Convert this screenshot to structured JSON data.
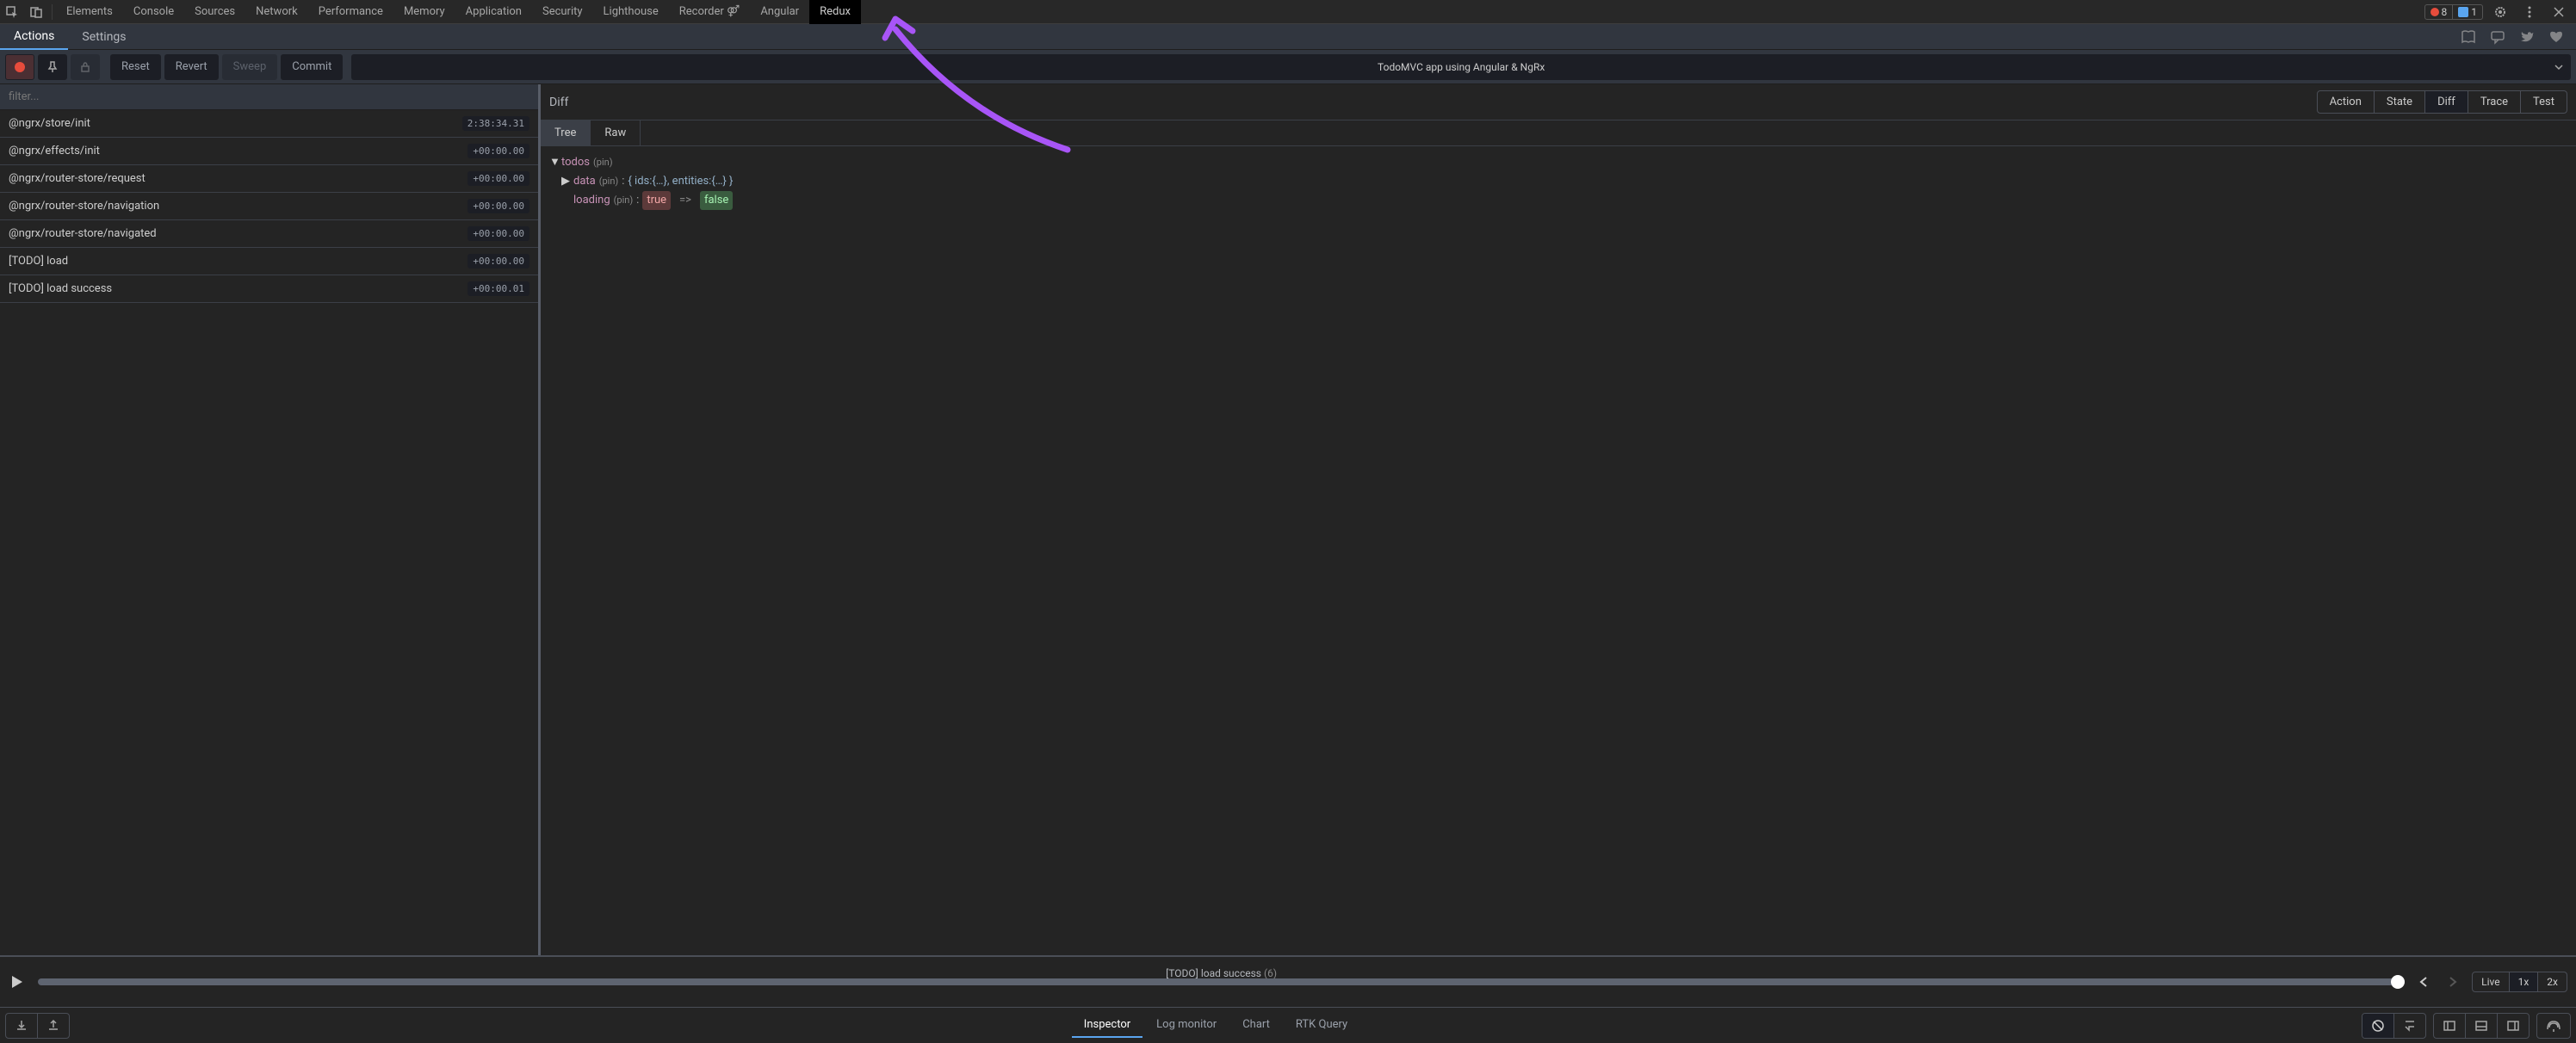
{
  "devtools": {
    "tabs": [
      "Elements",
      "Console",
      "Sources",
      "Network",
      "Performance",
      "Memory",
      "Application",
      "Security",
      "Lighthouse",
      "Recorder ⚤",
      "Angular",
      "Redux"
    ],
    "active_tab": "Redux",
    "error_count": "8",
    "issue_count": "1"
  },
  "redux_subtabs": {
    "tabs": [
      "Actions",
      "Settings"
    ],
    "active": "Actions"
  },
  "toolbar": {
    "reset": "Reset",
    "revert": "Revert",
    "sweep": "Sweep",
    "commit": "Commit",
    "title": "TodoMVC app using Angular & NgRx"
  },
  "filter": {
    "placeholder": "filter..."
  },
  "actions": [
    {
      "name": "@ngrx/store/init",
      "ts": "2:38:34.31"
    },
    {
      "name": "@ngrx/effects/init",
      "ts": "+00:00.00"
    },
    {
      "name": "@ngrx/router-store/request",
      "ts": "+00:00.00"
    },
    {
      "name": "@ngrx/router-store/navigation",
      "ts": "+00:00.00"
    },
    {
      "name": "@ngrx/router-store/navigated",
      "ts": "+00:00.00"
    },
    {
      "name": "[TODO] load",
      "ts": "+00:00.00"
    },
    {
      "name": "[TODO] load success",
      "ts": "+00:00.01"
    }
  ],
  "diff": {
    "header": "Diff",
    "view_pills": [
      "Action",
      "State",
      "Diff",
      "Trace",
      "Test"
    ],
    "active_pill": "Diff",
    "tree_tabs": [
      "Tree",
      "Raw"
    ],
    "active_tree_tab": "Tree",
    "tree": {
      "root_key": "todos",
      "pin": "(pin)",
      "data_key": "data",
      "data_val": "{ ids:{…}, entities:{…} }",
      "loading_key": "loading",
      "loading_old": "true",
      "arrow": "=>",
      "loading_new": "false"
    }
  },
  "timeline": {
    "label_action": "[TODO] load success",
    "label_count": "(6)",
    "speed_labels": [
      "Live",
      "1x",
      "2x"
    ],
    "active_speed": "1x"
  },
  "bottom": {
    "tabs": [
      "Inspector",
      "Log monitor",
      "Chart",
      "RTK Query"
    ],
    "active": "Inspector"
  }
}
